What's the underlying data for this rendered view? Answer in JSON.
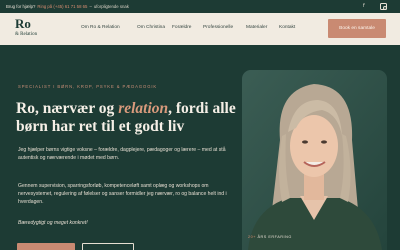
{
  "topbar": {
    "lead": "Brug for hjælp?",
    "phone": "Ring på (+45) 61 71 58 65",
    "separator": "–",
    "tail": "uforpligtende snak",
    "social_icons": [
      "facebook-icon",
      "instagram-icon"
    ]
  },
  "logo": {
    "mark": "Ro",
    "subtitle": "& Relation"
  },
  "nav": {
    "items": [
      "Om Ro & Relation",
      "Om Christina",
      "Forældre",
      "Professionelle",
      "Materialer",
      "Kontakt"
    ],
    "cta": "Book en samtale"
  },
  "hero": {
    "tagline": "SPECIALIST I BØRN, KROP, PSYKE & PÆDAGOGIK",
    "headline_part1": "Ro, nærvær og ",
    "headline_highlight": "relation",
    "headline_part2": ", fordi alle børn har ret til et godt liv",
    "paragraph1": "Jeg hjælper børns vigtige voksne – forældre, dagplejere, pædagoger og lærere – med at stå autentisk og nærværende i mødet med børn.",
    "paragraph2": "Gennem supervision, sparringsforløb, kompetenceløft samt oplæg og workshops om nervesystemet, regulering af følelser og sanser formidler jeg nærvær, ro og balance helt ind i hverdagen.",
    "note": "Bæredygtigt og meget konkret!",
    "experience_number": "20+",
    "experience_label": "ÅRS ERFARING"
  },
  "colors": {
    "background": "#1d3b34",
    "nav_background": "#f1ebe1",
    "accent": "#c98a72",
    "text_light": "#f3ece3"
  }
}
